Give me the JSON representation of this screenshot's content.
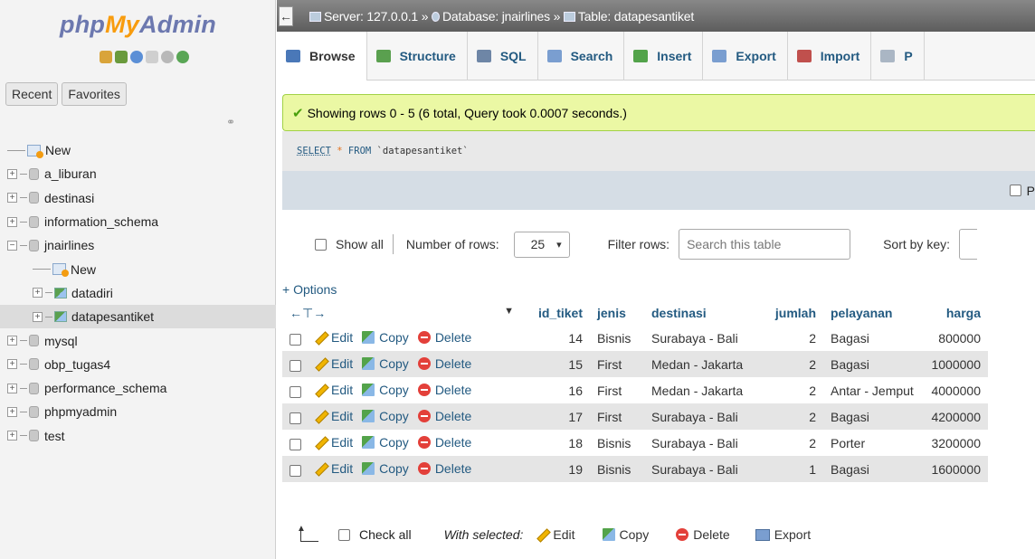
{
  "logo": {
    "part1": "php",
    "part2": "My",
    "part3": "Admin"
  },
  "sidebar": {
    "tabs": [
      "Recent",
      "Favorites"
    ],
    "tree": [
      {
        "label": "New",
        "kind": "new",
        "level": 0
      },
      {
        "label": "a_liburan",
        "kind": "db",
        "level": 0
      },
      {
        "label": "destinasi",
        "kind": "db",
        "level": 0
      },
      {
        "label": "information_schema",
        "kind": "db",
        "level": 0
      },
      {
        "label": "jnairlines",
        "kind": "db",
        "level": 0,
        "expanded": true
      },
      {
        "label": "New",
        "kind": "new",
        "level": 1
      },
      {
        "label": "datadiri",
        "kind": "table",
        "level": 1
      },
      {
        "label": "datapesantiket",
        "kind": "table",
        "level": 1,
        "active": true
      },
      {
        "label": "mysql",
        "kind": "db",
        "level": 0
      },
      {
        "label": "obp_tugas4",
        "kind": "db",
        "level": 0
      },
      {
        "label": "performance_schema",
        "kind": "db",
        "level": 0
      },
      {
        "label": "phpmyadmin",
        "kind": "db",
        "level": 0
      },
      {
        "label": "test",
        "kind": "db",
        "level": 0
      }
    ]
  },
  "breadcrumb": {
    "server": "Server: 127.0.0.1 »",
    "database": "Database: jnairlines »",
    "table": "Table: datapesantiket"
  },
  "menu": {
    "tabs": [
      {
        "label": "Browse",
        "icon": "browse-icon",
        "color": "#4a78b8"
      },
      {
        "label": "Structure",
        "icon": "structure-icon",
        "color": "#5aa04f"
      },
      {
        "label": "SQL",
        "icon": "sql-icon",
        "color": "#6e86a6"
      },
      {
        "label": "Search",
        "icon": "search-icon",
        "color": "#7a9ed0"
      },
      {
        "label": "Insert",
        "icon": "insert-icon",
        "color": "#53a34a"
      },
      {
        "label": "Export",
        "icon": "export-icon",
        "color": "#7a9ed0"
      },
      {
        "label": "Import",
        "icon": "import-icon",
        "color": "#c0504d"
      },
      {
        "label": "P",
        "icon": "privileges-icon",
        "color": "#aab6c4"
      }
    ]
  },
  "message": {
    "success": "Showing rows 0 - 5 (6 total, Query took 0.0007 seconds.)"
  },
  "sql": {
    "select": "SELECT",
    "star": "*",
    "from": "FROM",
    "table": "`datapesantiket`"
  },
  "profiling": {
    "label": "P"
  },
  "nav": {
    "show_all": "Show all",
    "rows_label": "Number of rows:",
    "rows_value": "25",
    "filter_label": "Filter rows:",
    "filter_placeholder": "Search this table",
    "sort_label": "Sort by key:"
  },
  "options_link": "+ Options",
  "table": {
    "columns": [
      "id_tiket",
      "jenis",
      "destinasi",
      "jumlah",
      "pelayanan",
      "harga"
    ],
    "actions": {
      "edit": "Edit",
      "copy": "Copy",
      "delete": "Delete"
    },
    "rows": [
      {
        "id_tiket": "14",
        "jenis": "Bisnis",
        "destinasi": "Surabaya - Bali",
        "jumlah": "2",
        "pelayanan": "Bagasi",
        "harga": "800000"
      },
      {
        "id_tiket": "15",
        "jenis": "First",
        "destinasi": "Medan - Jakarta",
        "jumlah": "2",
        "pelayanan": "Bagasi",
        "harga": "1000000"
      },
      {
        "id_tiket": "16",
        "jenis": "First",
        "destinasi": "Medan - Jakarta",
        "jumlah": "2",
        "pelayanan": "Antar - Jemput",
        "harga": "4000000"
      },
      {
        "id_tiket": "17",
        "jenis": "First",
        "destinasi": "Surabaya - Bali",
        "jumlah": "2",
        "pelayanan": "Bagasi",
        "harga": "4200000"
      },
      {
        "id_tiket": "18",
        "jenis": "Bisnis",
        "destinasi": "Surabaya - Bali",
        "jumlah": "2",
        "pelayanan": "Porter",
        "harga": "3200000"
      },
      {
        "id_tiket": "19",
        "jenis": "Bisnis",
        "destinasi": "Surabaya - Bali",
        "jumlah": "1",
        "pelayanan": "Bagasi",
        "harga": "1600000"
      }
    ]
  },
  "bottom": {
    "check_all": "Check all",
    "with_selected": "With selected:",
    "edit": "Edit",
    "copy": "Copy",
    "delete": "Delete",
    "export": "Export"
  }
}
